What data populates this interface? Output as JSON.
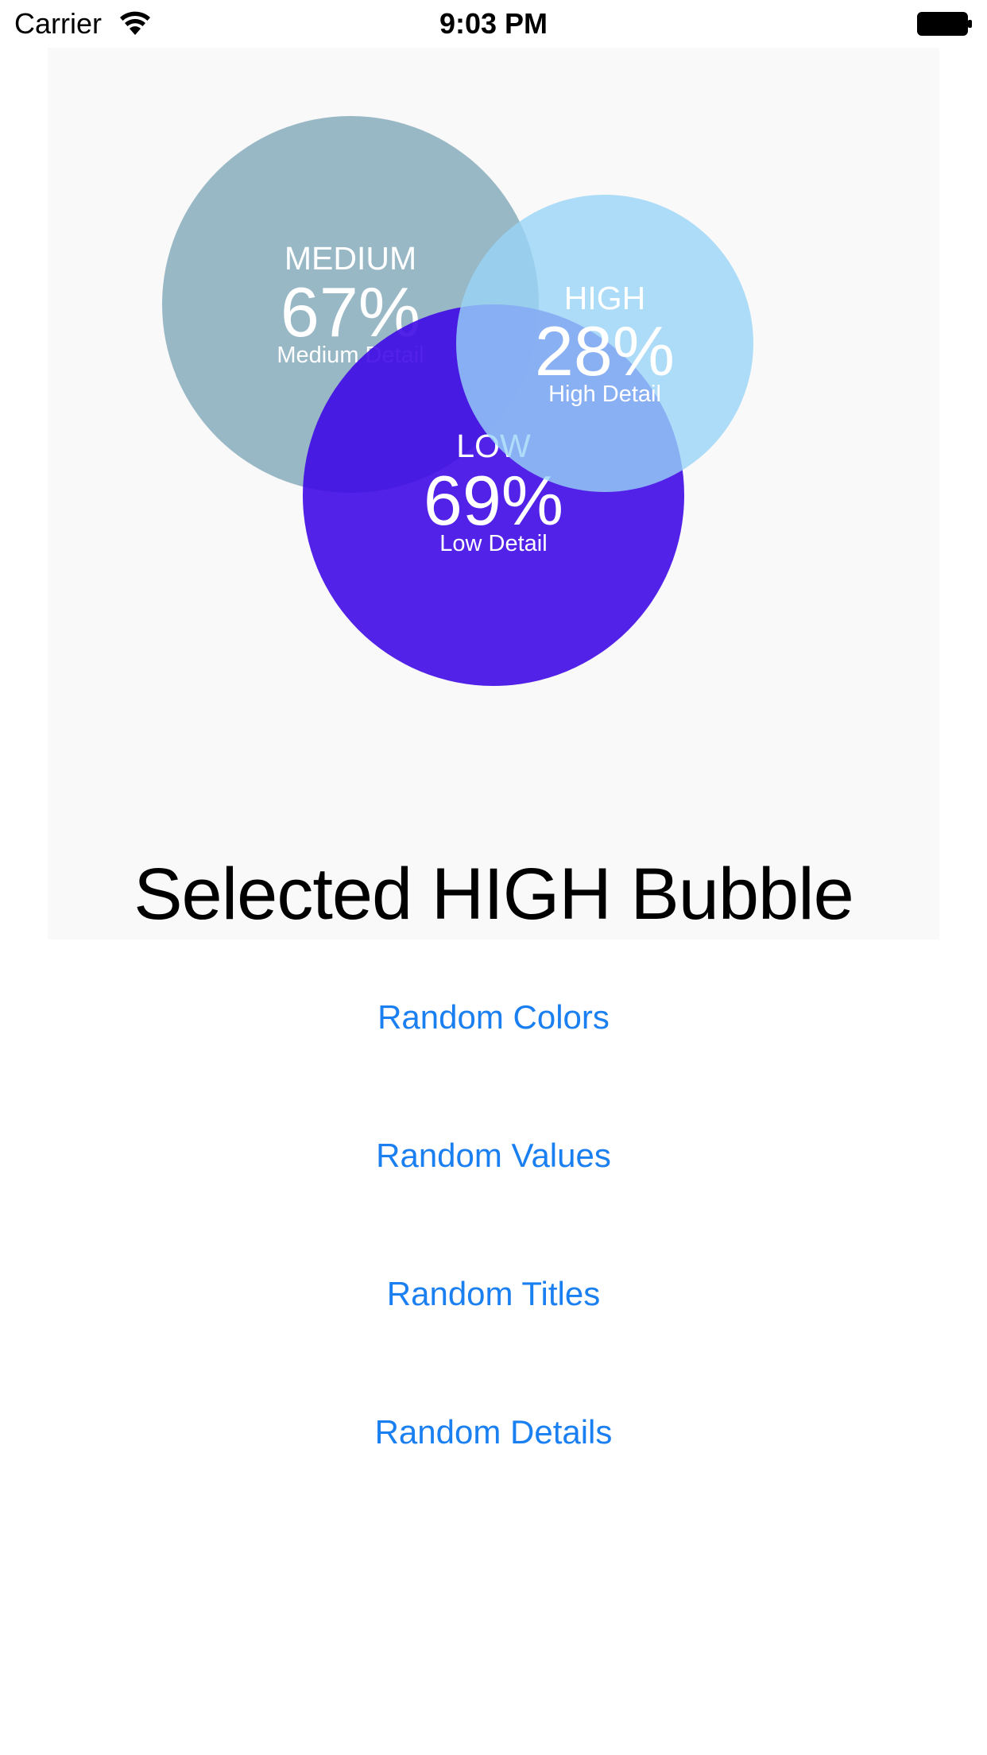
{
  "status_bar": {
    "carrier": "Carrier",
    "time": "9:03 PM",
    "icons": [
      "wifi-icon",
      "battery-icon"
    ]
  },
  "chart_data": {
    "type": "bubble",
    "bubbles": [
      {
        "title": "MEDIUM",
        "value": 67,
        "value_label": "67%",
        "detail": "Medium Detail",
        "color": "#8eb0c0"
      },
      {
        "title": "HIGH",
        "value": 28,
        "value_label": "28%",
        "detail": "High Detail",
        "color": "#98d4f6"
      },
      {
        "title": "LOW",
        "value": 69,
        "value_label": "69%",
        "detail": "Low Detail",
        "color": "#3f0ae6"
      }
    ]
  },
  "selection_label": "Selected HIGH Bubble",
  "buttons": {
    "random_colors": "Random Colors",
    "random_values": "Random Values",
    "random_titles": "Random Titles",
    "random_details": "Random Details"
  },
  "colors": {
    "panel_background": "#f9f9f9",
    "button_text": "#1a7ff0"
  }
}
